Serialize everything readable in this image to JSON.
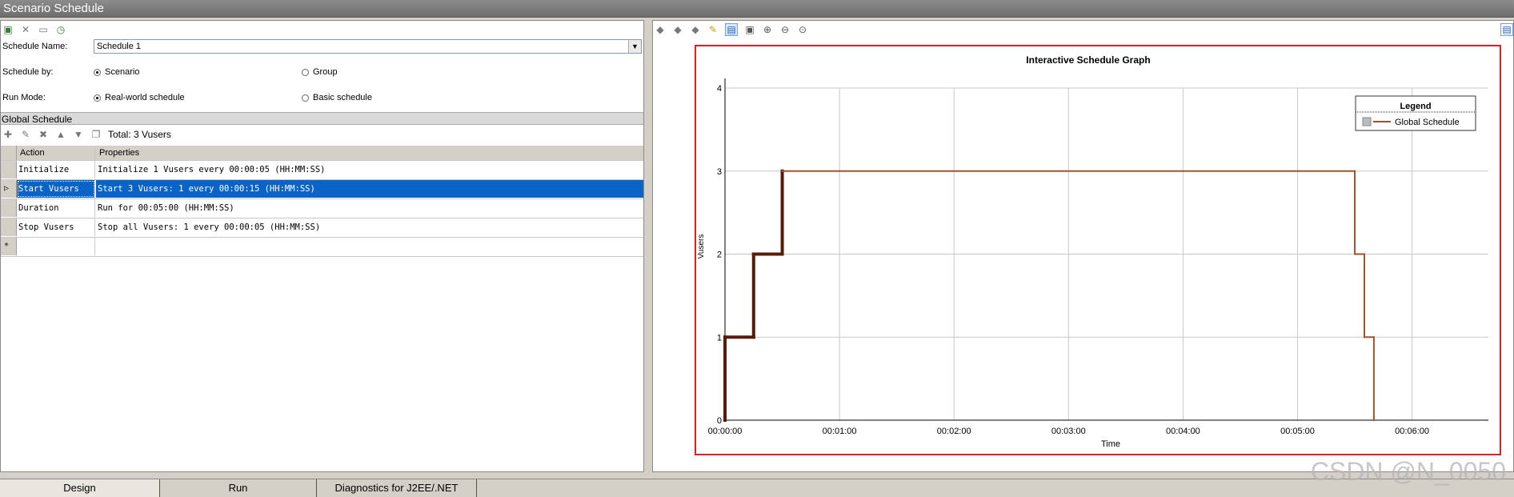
{
  "window": {
    "title": "Scenario Schedule"
  },
  "form": {
    "schedule_name_label": "Schedule Name:",
    "schedule_name_value": "Schedule 1",
    "schedule_by_label": "Schedule by:",
    "schedule_by_options": [
      "Scenario",
      "Group"
    ],
    "schedule_by_selected": "Scenario",
    "run_mode_label": "Run Mode:",
    "run_mode_options": [
      "Real-world schedule",
      "Basic schedule"
    ],
    "run_mode_selected": "Real-world schedule"
  },
  "global_schedule": {
    "title": "Global Schedule",
    "total_label": "Total: 3 Vusers",
    "columns": [
      "Action",
      "Properties"
    ],
    "rows": [
      {
        "action": "Initialize",
        "properties": "Initialize 1 Vusers every 00:00:05 (HH:MM:SS)"
      },
      {
        "action": "Start  Vusers",
        "properties": "Start 3 Vusers: 1 every 00:00:15 (HH:MM:SS)"
      },
      {
        "action": "Duration",
        "properties": "Run for 00:05:00 (HH:MM:SS)"
      },
      {
        "action": "Stop Vusers",
        "properties": "Stop all Vusers: 1 every 00:00:05 (HH:MM:SS)"
      }
    ],
    "new_row_marker": "*",
    "selected_row": 1
  },
  "chart_data": {
    "type": "line",
    "title": "Interactive Schedule Graph",
    "xlabel": "Time",
    "ylabel": "Vusers",
    "x_tick_labels": [
      "00:00:00",
      "00:01:00",
      "00:02:00",
      "00:03:00",
      "00:04:00",
      "00:05:00",
      "00:06:00"
    ],
    "y_ticks": [
      0,
      1,
      2,
      3,
      4
    ],
    "xlim_seconds": [
      0,
      400
    ],
    "ylim": [
      0,
      4
    ],
    "grid": true,
    "legend": {
      "title": "Legend",
      "position": "top-right",
      "entries": [
        "Global Schedule"
      ]
    },
    "series": [
      {
        "name": "Global Schedule",
        "color": "#a0522d",
        "ramp_color": "#5a1a0a",
        "points_seconds": [
          [
            0,
            0
          ],
          [
            0,
            1
          ],
          [
            15,
            1
          ],
          [
            15,
            2
          ],
          [
            30,
            2
          ],
          [
            30,
            3
          ],
          [
            330,
            3
          ],
          [
            330,
            2
          ],
          [
            335,
            2
          ],
          [
            335,
            1
          ],
          [
            340,
            1
          ],
          [
            340,
            0
          ]
        ]
      }
    ]
  },
  "tabs": [
    "Design",
    "Run",
    "Diagnostics for J2EE/.NET"
  ],
  "active_tab": "Design",
  "watermark": "CSDN @N_0050"
}
